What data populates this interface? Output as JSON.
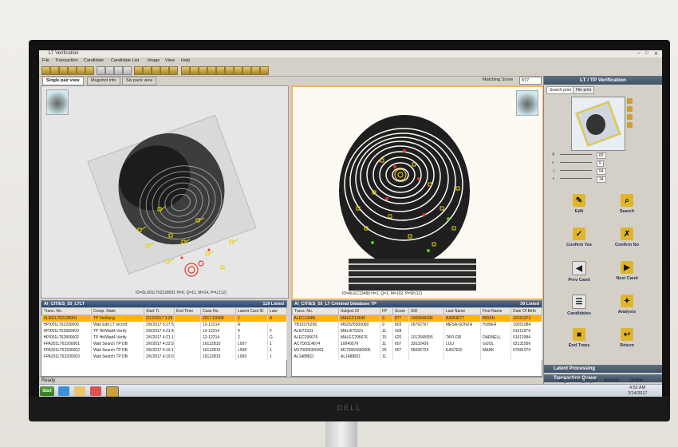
{
  "window": {
    "title": "LT Verification"
  },
  "menu": [
    "File",
    "Transaction",
    "Candidate",
    "Candidate List",
    "Image",
    "View",
    "Help"
  ],
  "tabs": [
    "Single pair view",
    "Mugshot info",
    "Six pack view"
  ],
  "matching": {
    "label": "Matching Score",
    "value": "877"
  },
  "left_image": {
    "caption": "ID=SL001LT62128001 H=0, Q=11, M=24, P=U:(12)"
  },
  "right_image": {
    "caption": "ID=ALEC13486 H=1, Q=1, M=102, P=W:(12)"
  },
  "panel": {
    "title": "LT / TP Verification",
    "tabs": [
      "Search print",
      "File print"
    ],
    "zoom_values": [
      "83",
      "5",
      "54",
      "34"
    ],
    "buttons": [
      {
        "label": "Edit",
        "icon": "edit-icon"
      },
      {
        "label": "Search",
        "icon": "search-icon"
      },
      {
        "label": "Confirm Yes",
        "icon": "confirm-yes-icon"
      },
      {
        "label": "Confirm No",
        "icon": "confirm-no-icon"
      },
      {
        "label": "Prev Cand",
        "icon": "prev-icon"
      },
      {
        "label": "Next Cand",
        "icon": "next-icon"
      },
      {
        "label": "Candidates",
        "icon": "candidates-icon"
      },
      {
        "label": "Analysis",
        "icon": "analysis-icon"
      },
      {
        "label": "End Trans",
        "icon": "end-trans-icon"
      },
      {
        "label": "Return",
        "icon": "return-icon"
      }
    ],
    "sections": [
      "Latent Processing",
      "Transaction Queue"
    ]
  },
  "left_list": {
    "title": "AI_CITIES_55_LTLT",
    "count": "119 Listed",
    "columns": [
      "Trans. No.",
      "Comp. State",
      "Start Ti.",
      "End Time",
      "Case No.",
      "Latent Card ID",
      "Late"
    ],
    "rows": [
      [
        "SL001LT62128001",
        "TP Verifying",
        "2/12/2017 3:28",
        "",
        "2017-03409",
        "1",
        "A"
      ],
      [
        "HPI001LT62200006",
        "Wait Edit LT record",
        "2/8/2017 5:27:5",
        "",
        "12-12214",
        "R",
        ""
      ],
      [
        "HPI001LT62800003",
        "TP Hit/Wait4 Verify",
        "2/8/2017 4:21:4.",
        "",
        "12-12214",
        "4",
        "F"
      ],
      [
        "HPI001LT62800002",
        "TP Hit/Wait4 Verify",
        "2/6/2017 4:21:1.",
        "",
        "12-12214",
        "2",
        "G"
      ],
      [
        "FPA201LT62200001",
        "Wait Search TP DB",
        "2/6/2017 4:22:5.",
        "",
        "16112B10",
        "L007",
        "1"
      ],
      [
        "FPA201LT62200002",
        "Wait Search TP DB",
        "2/6/2017 4:19:1.",
        "",
        "16112B10",
        "L008",
        "1"
      ],
      [
        "FPA201LT62200003",
        "Wait Search TP DB",
        "2/6/2017 4:19:0.",
        "",
        "16112B10",
        "L009",
        "1"
      ]
    ]
  },
  "right_list": {
    "title": "AI_CITIES_55_LT Criminal Database TP",
    "count": "30 Listed",
    "columns": [
      "Trans. No.",
      "Subject ID",
      "FP",
      "Score",
      "SID",
      "Last Name",
      "First Name",
      "Date Of Birth"
    ],
    "rows": [
      [
        "ALEC13486",
        "MALEC13640",
        "9",
        "877",
        "1009946436",
        "BARNETT",
        "BRIAN",
        "10151972"
      ],
      [
        "TB10376296",
        "M8Z8Z8300060",
        "9",
        "803",
        "26762767",
        "MESA-SONZA",
        "HUBER",
        "10051984"
      ],
      [
        "ALI675331",
        "MALI675331",
        "11",
        "628",
        "",
        "",
        "",
        "01011974"
      ],
      [
        "ALEC295676",
        "MALEC295676",
        "15",
        "620",
        "1012645055",
        "TAYLOR",
        "DARNELL",
        "01011984"
      ],
      [
        "ACTD0114674",
        "10049576",
        "11",
        "607",
        "32632426",
        "LUU",
        "GUOL",
        "02131956"
      ],
      [
        "M170009300001",
        "M170009300005",
        "20",
        "607",
        "05065729",
        "EASTER",
        "MARK",
        "07081970"
      ],
      [
        "AL1488811",
        "AL1488811",
        "11",
        "",
        "",
        "",
        "",
        ""
      ]
    ]
  },
  "statusbar": {
    "left": "Ready",
    "items": [
      "AI_CITIES_55_LT",
      "dinmon",
      "Online"
    ]
  },
  "taskbar": {
    "start": "Start",
    "time": "4:52 AM",
    "date": "2/14/2017"
  },
  "colors": {
    "highlight": "#ffb500",
    "header": "#3f5266",
    "frame": "#f0b36a"
  }
}
